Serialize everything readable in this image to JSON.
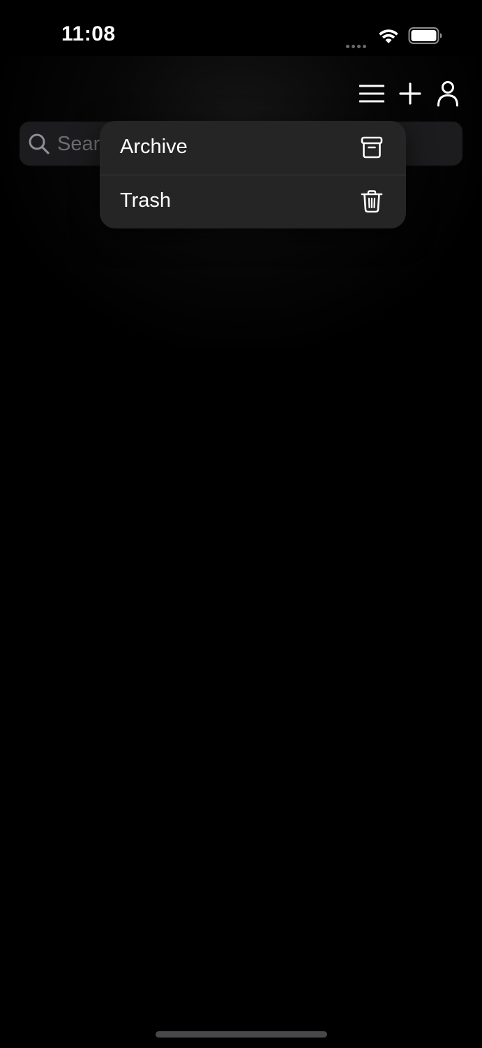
{
  "status_bar": {
    "time": "11:08",
    "icons": [
      "signal-dots-icon",
      "wifi-icon",
      "battery-icon"
    ]
  },
  "toolbar": {
    "icons": [
      "menu-lines-icon",
      "plus-icon",
      "person-icon"
    ]
  },
  "search": {
    "placeholder": "Search",
    "icon": "search-icon"
  },
  "context_menu": {
    "items": [
      {
        "label": "Archive",
        "icon": "archive-box-icon"
      },
      {
        "label": "Trash",
        "icon": "trash-icon"
      }
    ]
  },
  "colors": {
    "background": "#000000",
    "search_field": "#1c1c1e",
    "menu_background": "#252525",
    "menu_divider": "#3a3a3c",
    "text_primary": "#ffffff",
    "placeholder": "#6d6d72"
  }
}
